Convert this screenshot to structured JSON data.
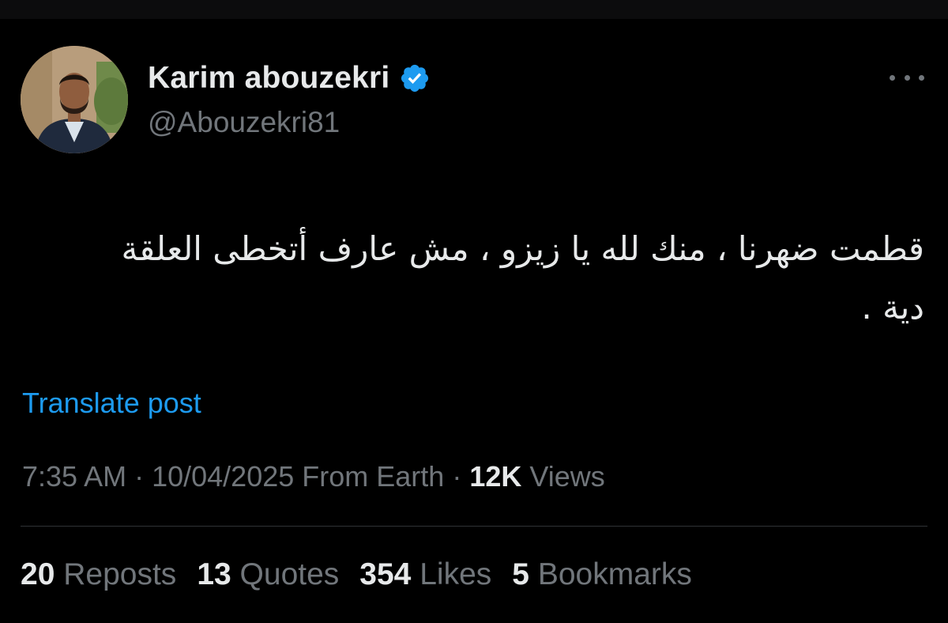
{
  "author": {
    "display_name": "Karim abouzekri",
    "handle": "@Abouzekri81",
    "verified": true
  },
  "icons": {
    "verified": "verified-badge-icon",
    "more": "more-options-icon",
    "avatar": "profile-photo"
  },
  "tweet": {
    "text_line1": "قطمت ضهرنا ، منك لله يا زيزو ، مش عارف أتخطى العلقة",
    "text_line2": "دية ."
  },
  "translate_label": "Translate post",
  "meta": {
    "time": "7:35 AM",
    "sep1": " · ",
    "date": "10/04/2025",
    "source": " From Earth",
    "sep2": " · ",
    "views_count": "12K",
    "views_label": " Views"
  },
  "stats": {
    "reposts_count": "20",
    "reposts_label": "Reposts",
    "quotes_count": "13",
    "quotes_label": "Quotes",
    "likes_count": "354",
    "likes_label": "Likes",
    "bookmarks_count": "5",
    "bookmarks_label": "Bookmarks"
  },
  "colors": {
    "background": "#000000",
    "text_primary": "#e7e9ea",
    "text_secondary": "#71767b",
    "accent_blue": "#1d9bf0",
    "divider": "#2f3336"
  }
}
